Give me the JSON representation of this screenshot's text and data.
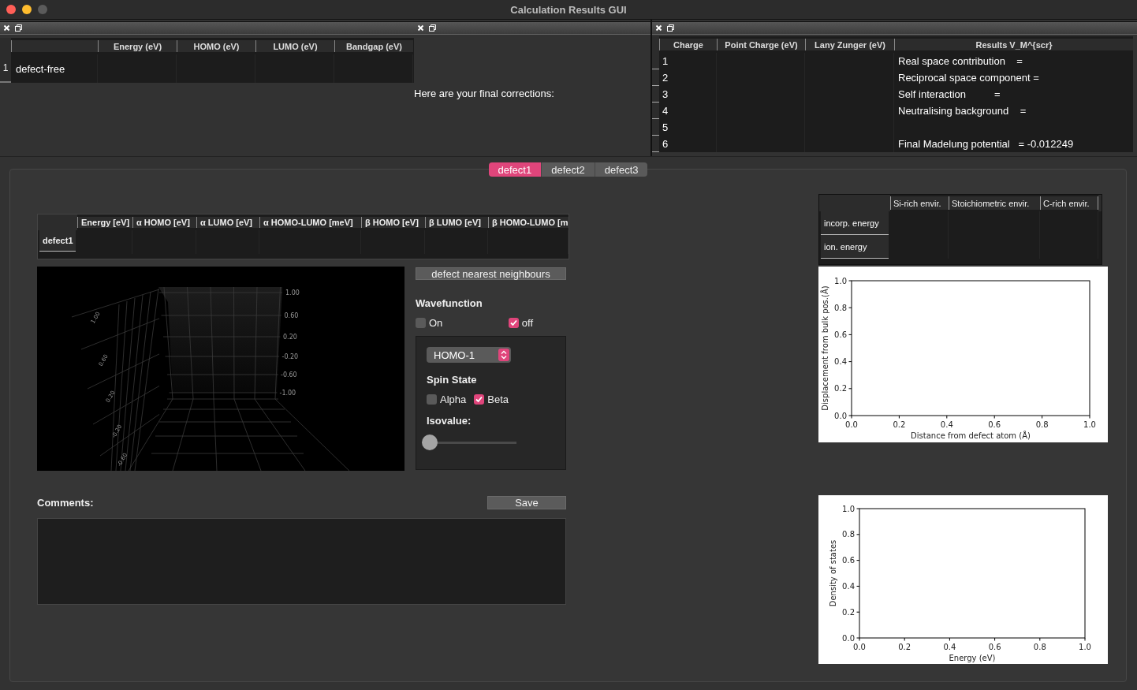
{
  "window": {
    "title": "Calculation Results GUI"
  },
  "defect_free_table": {
    "columns": [
      "Energy (eV)",
      "HOMO (eV)",
      "LUMO (eV)",
      "Bandgap (eV)"
    ],
    "rows": [
      {
        "number": "1",
        "label": "defect-free"
      }
    ]
  },
  "corrections": {
    "label": "Here are your final corrections:"
  },
  "charge_table": {
    "columns": [
      "Charge",
      "Point Charge (eV)",
      "Lany Zunger (eV)",
      "Results     V_M^{scr}"
    ],
    "rows": [
      {
        "charge": "1",
        "result": "Real space contribution    ="
      },
      {
        "charge": "2",
        "result": "Reciprocal space component ="
      },
      {
        "charge": "3",
        "result": "Self interaction          ="
      },
      {
        "charge": "4",
        "result": "Neutralising background    ="
      },
      {
        "charge": "5"
      },
      {
        "charge": "6",
        "result": "Final Madelung potential   = -0.012249"
      }
    ]
  },
  "tabs": [
    {
      "label": "defect1",
      "selected": true
    },
    {
      "label": "defect2",
      "selected": false
    },
    {
      "label": "defect3",
      "selected": false
    }
  ],
  "defect_table": {
    "columns": [
      "Energy [eV]",
      "α HOMO [eV]",
      "α LUMO [eV]",
      "α HOMO-LUMO [meV]",
      "β HOMO [eV]",
      "β LUMO [eV]",
      "β HOMO-LUMO [m"
    ],
    "rows": [
      {
        "label": "defect1"
      }
    ]
  },
  "plot3d": {
    "right_ticks": [
      "1.00",
      "0.60",
      "0.20",
      "-0.20",
      "-0.60",
      "-1.00"
    ],
    "left_ticks": [
      "1.00",
      "0.60",
      "0.20",
      "-0.20",
      "-0.60"
    ]
  },
  "neighbours_button": "defect nearest neighbours",
  "wavefunction": {
    "label": "Wavefunction",
    "options": [
      {
        "label": "On",
        "checked": false
      },
      {
        "label": "off",
        "checked": true
      }
    ]
  },
  "orbital_select": {
    "value": "HOMO-1"
  },
  "spin_state": {
    "label": "Spin State",
    "options": [
      {
        "label": "Alpha",
        "checked": false
      },
      {
        "label": "Beta",
        "checked": true
      }
    ]
  },
  "isovalue": {
    "label": "Isovalue:",
    "level": 0
  },
  "comments": {
    "label": "Comments:",
    "save_button": "Save"
  },
  "energy_table": {
    "columns": [
      "Si-rich envir.",
      "Stoichiometric envir.",
      "C-rich envir."
    ],
    "rows": [
      "incorp. energy",
      "ion. energy"
    ]
  },
  "displacement_chart": {
    "chart_data": {
      "type": "line",
      "xlabel": "Distance from defect atom (Å)",
      "ylabel": "Displacement from bulk pos.(Å)",
      "xlim": [
        0,
        1
      ],
      "ylim": [
        0,
        1
      ],
      "xticks": [
        {
          "value": 0,
          "label": "0.0"
        },
        {
          "value": 0.2,
          "label": "0.2"
        },
        {
          "value": 0.4,
          "label": "0.4"
        },
        {
          "value": 0.6,
          "label": "0.6"
        },
        {
          "value": 0.8,
          "label": "0.8"
        },
        {
          "value": 1,
          "label": "1.0"
        }
      ],
      "yticks": [
        {
          "value": 0,
          "label": "0.0"
        },
        {
          "value": 0.2,
          "label": "0.2"
        },
        {
          "value": 0.4,
          "label": "0.4"
        },
        {
          "value": 0.6,
          "label": "0.6"
        },
        {
          "value": 0.8,
          "label": "0.8"
        },
        {
          "value": 1,
          "label": "1.0"
        }
      ]
    }
  },
  "dos_chart": {
    "chart_data": {
      "type": "line",
      "xlabel": "Energy (eV)",
      "ylabel": "Density of states",
      "xlim": [
        0,
        1
      ],
      "ylim": [
        0,
        1
      ],
      "xticks": [
        {
          "value": 0,
          "label": "0.0"
        },
        {
          "value": 0.2,
          "label": "0.2"
        },
        {
          "value": 0.4,
          "label": "0.4"
        },
        {
          "value": 0.6,
          "label": "0.6"
        },
        {
          "value": 0.8,
          "label": "0.8"
        },
        {
          "value": 1,
          "label": "1.0"
        }
      ],
      "yticks": [
        {
          "value": 0,
          "label": "0.0"
        },
        {
          "value": 0.2,
          "label": "0.2"
        },
        {
          "value": 0.4,
          "label": "0.4"
        },
        {
          "value": 0.6,
          "label": "0.6"
        },
        {
          "value": 0.8,
          "label": "0.8"
        },
        {
          "value": 1,
          "label": "1.0"
        }
      ]
    }
  }
}
